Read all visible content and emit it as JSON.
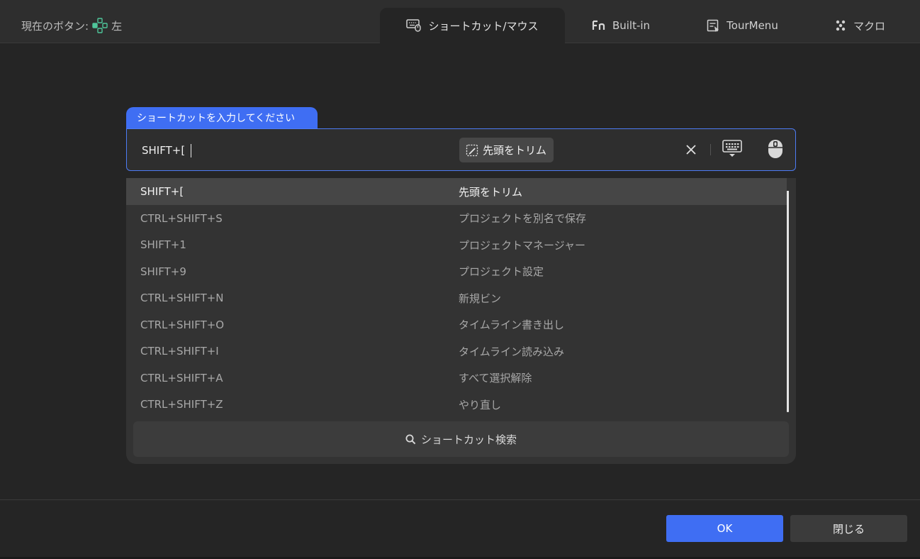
{
  "header": {
    "current_button_label": "現在のボタン:",
    "current_button_value": "左",
    "tabs": [
      {
        "label": "ショートカット/マウス",
        "icon": "keyboard-mouse-icon",
        "active": true
      },
      {
        "label": "Built-in",
        "icon": "fn-icon",
        "active": false
      },
      {
        "label": "TourMenu",
        "icon": "tour-menu-icon",
        "active": false
      },
      {
        "label": "マクロ",
        "icon": "macro-icon",
        "active": false
      }
    ]
  },
  "input": {
    "hint": "ショートカットを入力してください",
    "value": "SHIFT+[",
    "function_label": "先頭をトリム"
  },
  "list": {
    "rows": [
      {
        "key": "SHIFT+[",
        "function": "先頭をトリム",
        "selected": true
      },
      {
        "key": "CTRL+SHIFT+S",
        "function": "プロジェクトを別名で保存"
      },
      {
        "key": "SHIFT+1",
        "function": "プロジェクトマネージャー"
      },
      {
        "key": "SHIFT+9",
        "function": "プロジェクト設定"
      },
      {
        "key": "CTRL+SHIFT+N",
        "function": "新規ビン"
      },
      {
        "key": "CTRL+SHIFT+O",
        "function": "タイムライン書き出し"
      },
      {
        "key": "CTRL+SHIFT+I",
        "function": "タイムライン読み込み"
      },
      {
        "key": "CTRL+SHIFT+A",
        "function": "すべて選択解除"
      },
      {
        "key": "CTRL+SHIFT+Z",
        "function": "やり直し"
      }
    ]
  },
  "search": {
    "label": "ショートカット検索"
  },
  "footer": {
    "ok_label": "OK",
    "close_label": "閉じる"
  },
  "colors": {
    "accent": "#3f6ef3",
    "background": "#252525",
    "panel": "#333333"
  }
}
